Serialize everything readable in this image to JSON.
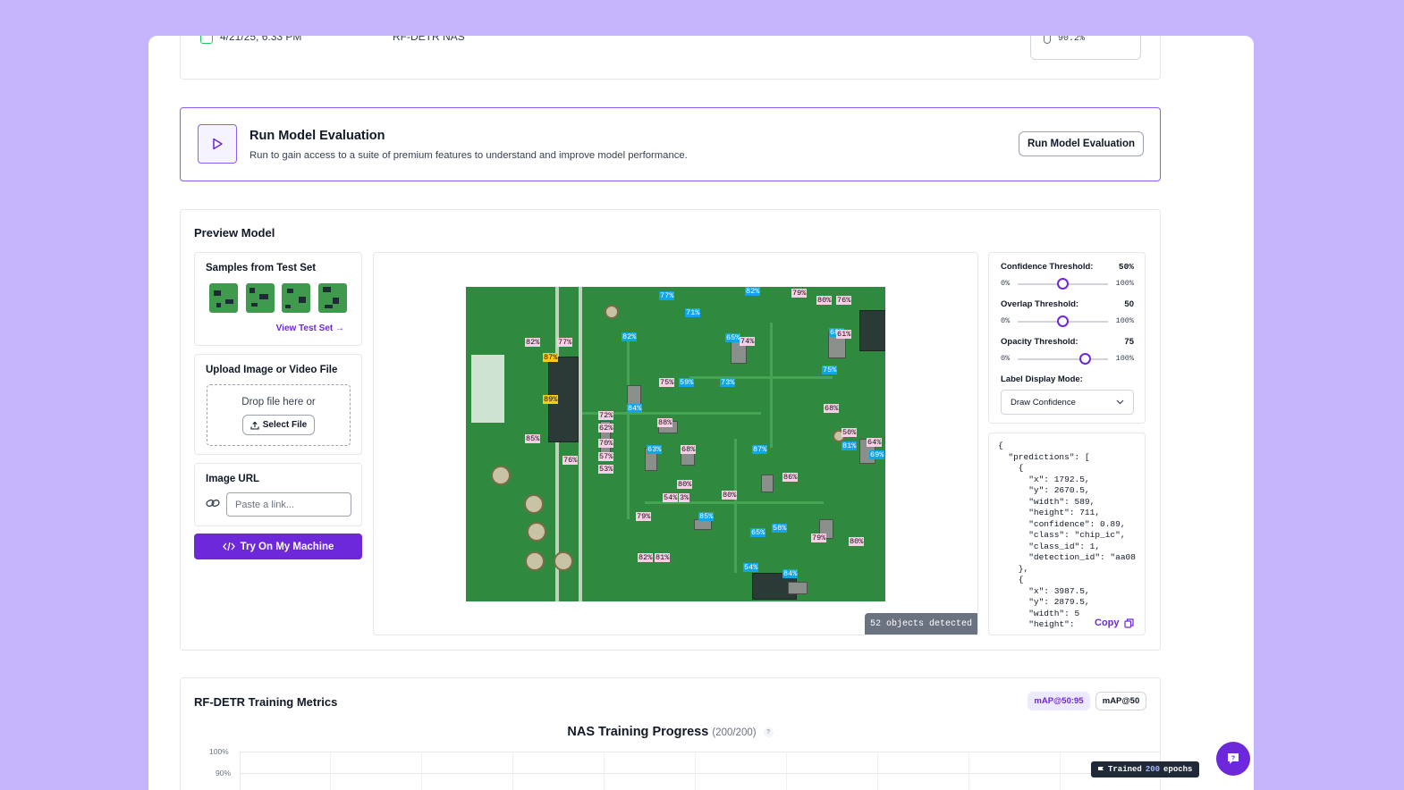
{
  "top_row": {
    "date": "4/21/25, 6:33 PM",
    "model": "RF-DETR NAS",
    "score": "90.2%"
  },
  "evaluation": {
    "title": "Run Model Evaluation",
    "description": "Run to gain access to a suite of premium features to understand and improve model performance.",
    "button_label": "Run Model Evaluation"
  },
  "preview": {
    "title": "Preview Model",
    "samples": {
      "title": "Samples from Test Set",
      "link_label": "View Test Set →"
    },
    "upload": {
      "title": "Upload Image or Video File",
      "drop_text": "Drop file here or",
      "button_label": "Select File"
    },
    "url": {
      "title": "Image URL",
      "placeholder": "Paste a link..."
    },
    "try_button_label": "Try On My Machine",
    "objects_detected": "52 objects detected",
    "detection_labels": [
      "82%",
      "77%",
      "87%",
      "89%",
      "85%",
      "72%",
      "62%",
      "70%",
      "57%",
      "53%",
      "76%",
      "82%",
      "77%",
      "71%",
      "82%",
      "65%",
      "74%",
      "79%",
      "80%",
      "76%",
      "68%",
      "61%",
      "75%",
      "75%",
      "59%",
      "73%",
      "84%",
      "88%",
      "68%",
      "63%",
      "68%",
      "87%",
      "50%",
      "81%",
      "64%",
      "69%",
      "86%",
      "80%",
      "54%",
      "3%",
      "80%",
      "79%",
      "85%",
      "65%",
      "58%",
      "79%",
      "80%",
      "82%",
      "81%",
      "54%",
      "84%"
    ],
    "controls": {
      "confidence": {
        "label": "Confidence Threshold:",
        "value": "50%",
        "level": 50,
        "min": "0%",
        "max": "100%"
      },
      "overlap": {
        "label": "Overlap Threshold:",
        "value": "50",
        "level": 50,
        "min": "0%",
        "max": "100%"
      },
      "opacity": {
        "label": "Opacity Threshold:",
        "value": "75",
        "level": 75,
        "min": "0%",
        "max": "100%"
      },
      "label_mode": {
        "label": "Label Display Mode:",
        "selected": "Draw Confidence"
      }
    },
    "json_output": "{\n  \"predictions\": [\n    {\n      \"x\": 1792.5,\n      \"y\": 2670.5,\n      \"width\": 589,\n      \"height\": 711,\n      \"confidence\": 0.89,\n      \"class\": \"chip_ic\",\n      \"class_id\": 1,\n      \"detection_id\": \"aa08\n    },\n    {\n      \"x\": 3987.5,\n      \"y\": 2879.5,\n      \"width\": 5\n      \"height\": ",
    "copy_label": "Copy"
  },
  "metrics": {
    "title": "RF-DETR Training Metrics",
    "toggle_a": "mAP@50:95",
    "toggle_b": "mAP@50",
    "chart_title": "NAS Training Progress",
    "chart_count": "(200/200)",
    "y_ticks": [
      "100%",
      "90%"
    ],
    "trained_prefix": "Trained",
    "trained_epochs": "200",
    "trained_suffix": "epochs"
  },
  "colors": {
    "accent": "#6d28d9",
    "background": "#c4b5fd",
    "pcb": "#2f8a40"
  }
}
